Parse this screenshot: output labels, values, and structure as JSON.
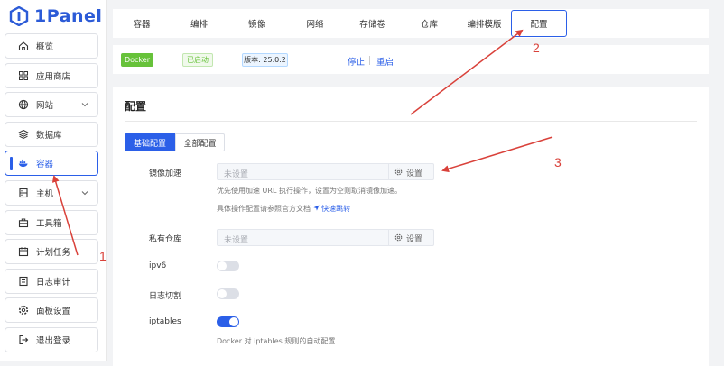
{
  "app": {
    "title": "1Panel"
  },
  "sidebar": {
    "items": [
      {
        "label": "概览",
        "icon": "home-icon",
        "active": false,
        "has_chevron": false
      },
      {
        "label": "应用商店",
        "icon": "apps-grid-icon",
        "active": false,
        "has_chevron": false
      },
      {
        "label": "网站",
        "icon": "globe-icon",
        "active": false,
        "has_chevron": true
      },
      {
        "label": "数据库",
        "icon": "database-icon",
        "active": false,
        "has_chevron": false
      },
      {
        "label": "容器",
        "icon": "docker-icon",
        "active": true,
        "has_chevron": false
      },
      {
        "label": "主机",
        "icon": "server-icon",
        "active": false,
        "has_chevron": true
      },
      {
        "label": "工具箱",
        "icon": "toolbox-icon",
        "active": false,
        "has_chevron": false
      },
      {
        "label": "计划任务",
        "icon": "calendar-icon",
        "active": false,
        "has_chevron": false
      },
      {
        "label": "日志审计",
        "icon": "log-icon",
        "active": false,
        "has_chevron": false
      },
      {
        "label": "面板设置",
        "icon": "gear-icon",
        "active": false,
        "has_chevron": false
      },
      {
        "label": "退出登录",
        "icon": "logout-icon",
        "active": false,
        "has_chevron": false
      }
    ]
  },
  "tabs": [
    {
      "label": "容器",
      "active": false
    },
    {
      "label": "编排",
      "active": false
    },
    {
      "label": "镜像",
      "active": false
    },
    {
      "label": "网络",
      "active": false
    },
    {
      "label": "存储卷",
      "active": false
    },
    {
      "label": "仓库",
      "active": false
    },
    {
      "label": "编排模版",
      "active": false
    },
    {
      "label": "配置",
      "active": true
    }
  ],
  "status_bar": {
    "app_badge": "Docker",
    "status_badge": "已启动",
    "version_badge": "版本: 25.0.2",
    "stop_link": "停止",
    "restart_link": "重启"
  },
  "config": {
    "title": "配置",
    "mode_buttons": {
      "basic": "基础配置",
      "full": "全部配置"
    },
    "mirror": {
      "label": "镜像加速",
      "placeholder": "未设置",
      "setting_button": "设置",
      "hint1": "优先使用加速 URL 执行操作，设置为空则取消镜像加速。",
      "hint2": "具体操作配置请参照官方文档",
      "quick_link": "快速跳转"
    },
    "registry": {
      "label": "私有仓库",
      "placeholder": "未设置",
      "setting_button": "设置"
    },
    "ipv6": {
      "label": "ipv6",
      "enabled": false
    },
    "log_rotate": {
      "label": "日志切割",
      "enabled": false
    },
    "iptables": {
      "label": "iptables",
      "enabled": true,
      "hint": "Docker 对 iptables 规则的自动配置"
    }
  },
  "annotations": {
    "one": "1",
    "two": "2",
    "three": "3"
  },
  "colors": {
    "accent": "#2b5fe8",
    "annotation": "#d9413a",
    "success": "#67c23a"
  }
}
